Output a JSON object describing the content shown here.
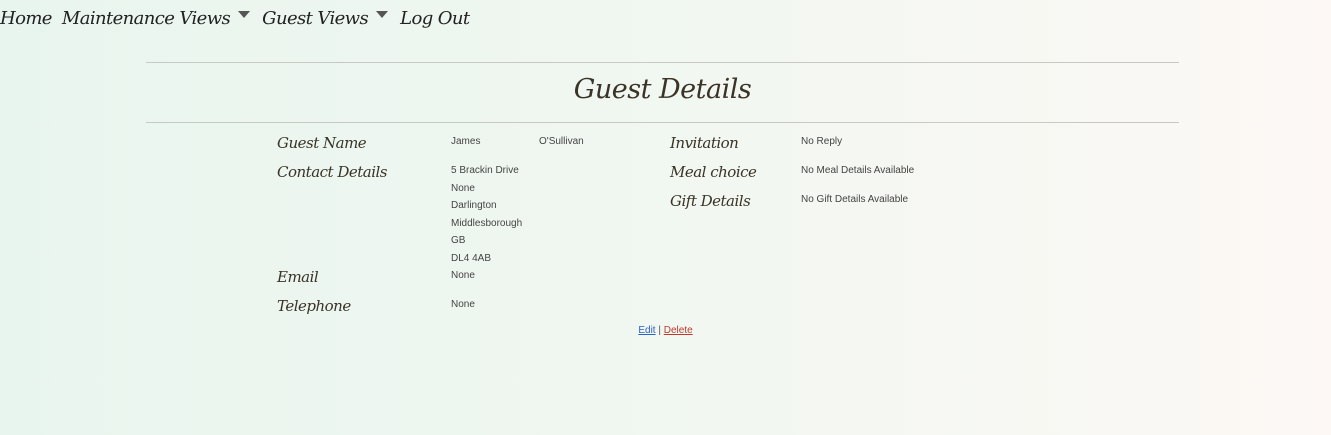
{
  "nav": {
    "home": "Home",
    "maintenance_views": "Maintenance Views",
    "guest_views": "Guest Views",
    "log_out": "Log Out"
  },
  "page": {
    "title": "Guest Details"
  },
  "guest": {
    "name_label": "Guest Name",
    "first_name": "James",
    "last_name": "O'Sullivan",
    "contact_label": "Contact Details",
    "address": [
      "5 Brackin Drive",
      "None",
      "Darlington",
      "Middlesborough",
      "GB",
      "DL4 4AB"
    ],
    "email_label": "Email",
    "email": "None",
    "telephone_label": "Telephone",
    "telephone": "None",
    "invitation_label": "Invitation",
    "invitation": "No Reply",
    "meal_label": "Meal choice",
    "meal": "No Meal Details Available",
    "gift_label": "Gift Details",
    "gift": "No Gift Details Available"
  },
  "actions": {
    "edit": "Edit",
    "separator": "|",
    "delete": "Delete"
  },
  "colors": {
    "link_edit": "#2a62c9",
    "link_delete": "#c0392b"
  }
}
